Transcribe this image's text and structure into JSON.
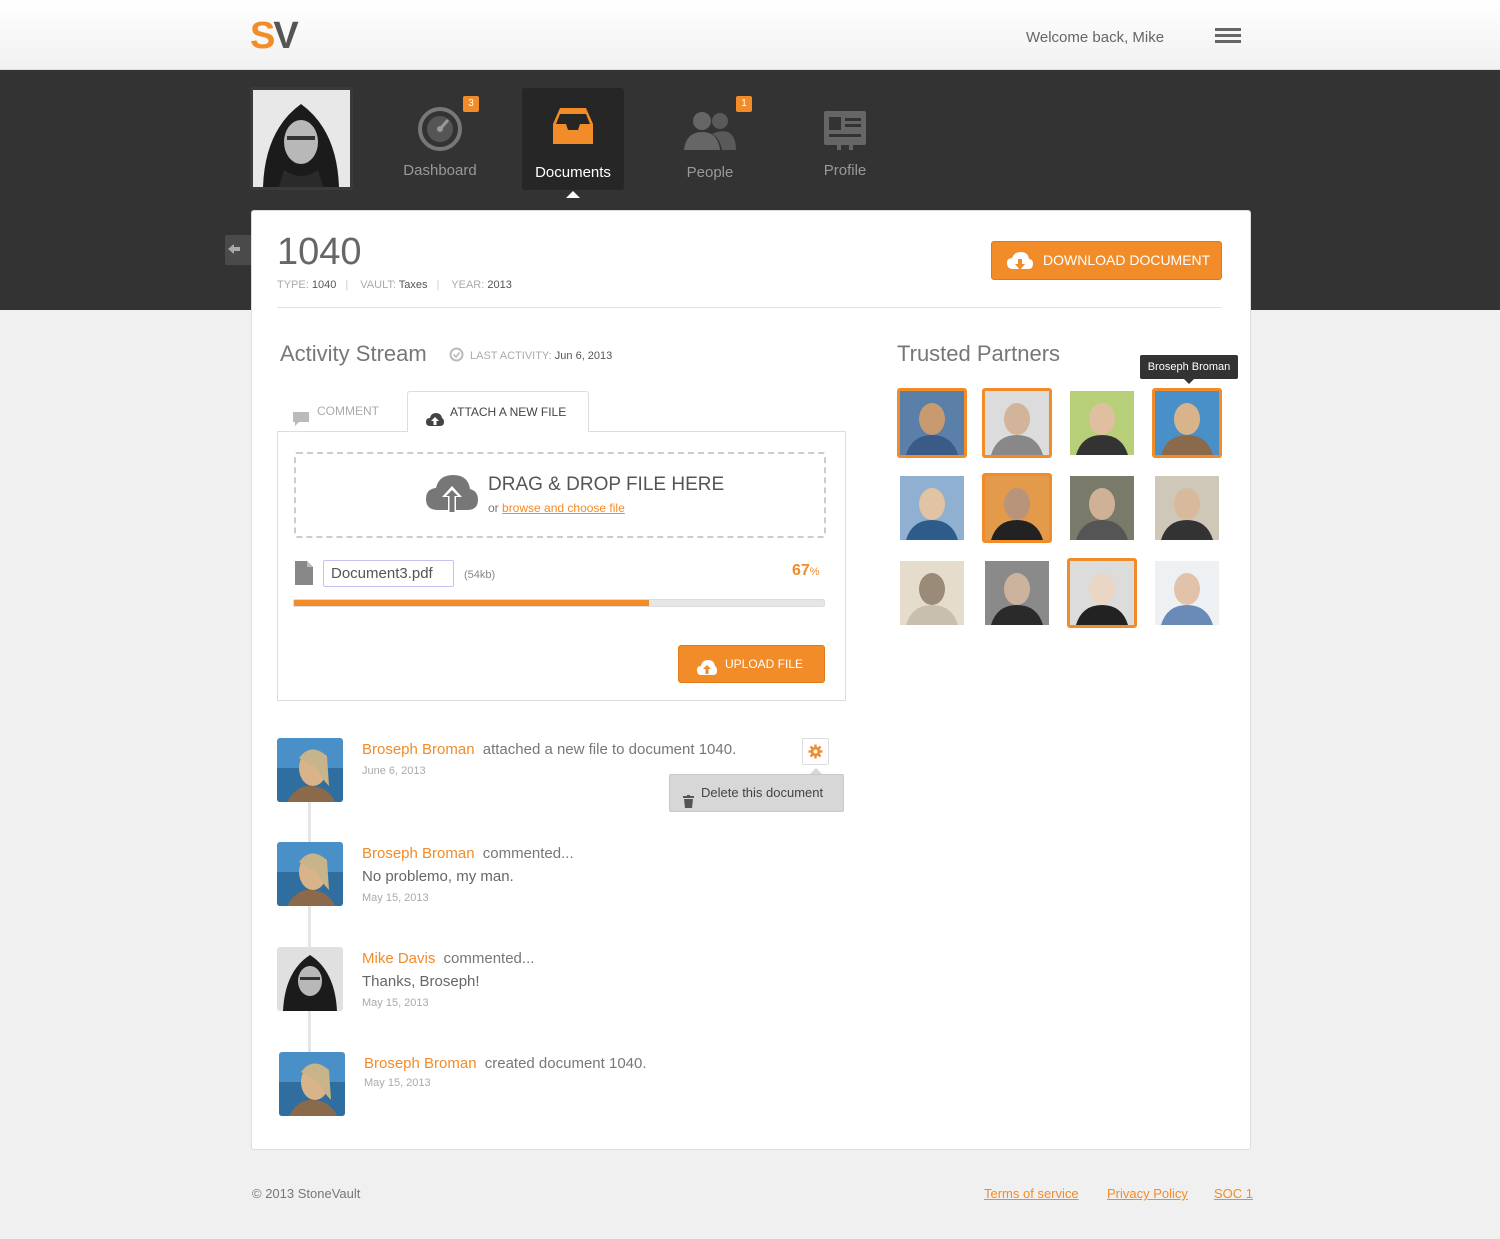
{
  "header": {
    "logo_s": "S",
    "logo_v": "V",
    "welcome": "Welcome back, Mike"
  },
  "nav": {
    "items": [
      {
        "label": "Dashboard",
        "badge": "3",
        "icon": "gauge-icon"
      },
      {
        "label": "Documents",
        "badge": "",
        "icon": "inbox-tray-icon",
        "active": true
      },
      {
        "label": "People",
        "badge": "1",
        "icon": "people-icon"
      },
      {
        "label": "Profile",
        "badge": "",
        "icon": "id-card-icon"
      }
    ]
  },
  "document": {
    "title": "1040",
    "type_label": "TYPE:",
    "type_value": "1040",
    "vault_label": "VAULT:",
    "vault_value": "Taxes",
    "year_label": "YEAR:",
    "year_value": "2013",
    "download_label": "DOWNLOAD DOCUMENT"
  },
  "activity": {
    "heading": "Activity Stream",
    "last_label": "LAST ACTIVITY:",
    "last_value": "Jun 6, 2013",
    "tabs": [
      {
        "label": "COMMENT"
      },
      {
        "label": "ATTACH A NEW FILE",
        "active": true
      }
    ],
    "drop_title": "DRAG & DROP FILE HERE",
    "drop_or": "or",
    "drop_link": "browse and choose file",
    "file_name": "Document3.pdf",
    "file_size": "(54kb)",
    "progress_value": "67",
    "progress_unit": "%",
    "progress_fraction": 0.67,
    "upload_label": "UPLOAD FILE"
  },
  "timeline": [
    {
      "name": "Broseph Broman",
      "action": "attached a new file to document 1040.",
      "message": "",
      "date": "June 6, 2013"
    },
    {
      "name": "Broseph Broman",
      "action": "commented...",
      "message": "No problemo, my man.",
      "date": "May 15, 2013"
    },
    {
      "name": "Mike Davis",
      "action": "commented...",
      "message": "Thanks, Broseph!",
      "date": "May 15, 2013"
    },
    {
      "name": "Broseph Broman",
      "action": "created document 1040.",
      "message": "",
      "date": "May 15, 2013"
    }
  ],
  "gear_menu": {
    "delete_label": "Delete this document"
  },
  "partners": {
    "heading": "Trusted Partners",
    "tooltip": "Broseph Broman",
    "highlighted": [
      0,
      1,
      3,
      5,
      10
    ]
  },
  "footer": {
    "copyright": "© 2013 StoneVault",
    "links": [
      "Terms of service",
      "Privacy Policy",
      "SOC 1"
    ]
  },
  "colors": {
    "accent": "#f28c28",
    "dark_band": "#333333",
    "background": "#f0f0f0"
  }
}
